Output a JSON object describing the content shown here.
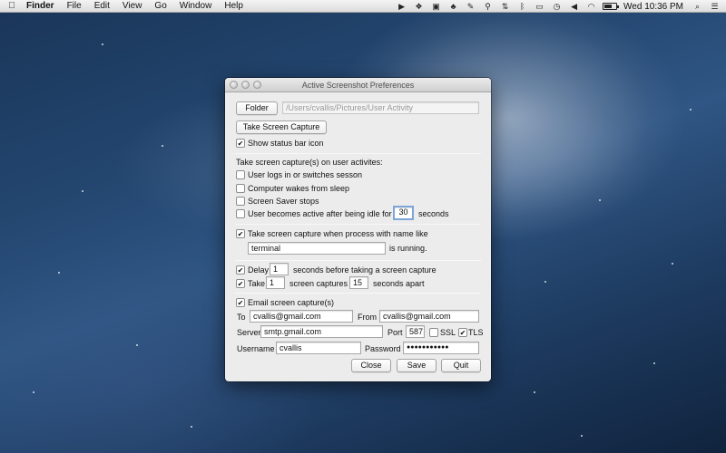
{
  "menubar": {
    "app": "Finder",
    "menus": [
      "File",
      "Edit",
      "View",
      "Go",
      "Window",
      "Help"
    ],
    "status_icons": [
      "screen-record-icon",
      "dropbox-icon",
      "window-icon",
      "evernote-icon",
      "pen-icon",
      "flashlight-icon",
      "network-icon",
      "bluetooth-icon",
      "screen-icon",
      "time-machine-icon",
      "volume-icon",
      "wifi-icon",
      "battery-icon",
      "search-icon",
      "list-icon"
    ],
    "battery_level": 0.65,
    "clock": "Wed 10:36 PM"
  },
  "window": {
    "title": "Active Screenshot Preferences",
    "folder_button": "Folder",
    "folder_path": "/Users/cvallis/Pictures/User Activity",
    "capture_button": "Take Screen Capture",
    "show_status_bar": {
      "label": "Show status bar icon",
      "checked": true
    },
    "activities_heading": "Take screen capture(s) on user activites:",
    "activities": [
      {
        "label": "User logs in or switches sesson",
        "checked": false
      },
      {
        "label": "Computer wakes from sleep",
        "checked": false
      },
      {
        "label": "Screen Saver stops",
        "checked": false
      }
    ],
    "idle": {
      "label": "User becomes active after being idle for",
      "checked": false,
      "value": "30",
      "unit": "seconds"
    },
    "process": {
      "label": "Take screen capture when process with name like",
      "checked": true,
      "name": "terminal",
      "suffix": "is running."
    },
    "delay": {
      "label": "Delay",
      "checked": true,
      "value": "1",
      "suffix": "seconds before taking a screen capture"
    },
    "take": {
      "label": "Take",
      "checked": true,
      "count": "1",
      "middle": "screen captures",
      "interval": "15",
      "suffix": "seconds apart"
    },
    "email": {
      "label": "Email screen capture(s)",
      "checked": true,
      "to_label": "To",
      "to": "cvallis@gmail.com",
      "from_label": "From",
      "from": "cvallis@gmail.com",
      "server_label": "Server",
      "server": "smtp.gmail.com",
      "port_label": "Port",
      "port": "587",
      "ssl_label": "SSL",
      "ssl": false,
      "tls_label": "TLS",
      "tls": true,
      "username_label": "Username",
      "username": "cvallis",
      "password_label": "Password",
      "password": "●●●●●●●●●●●"
    },
    "buttons": {
      "close": "Close",
      "save": "Save",
      "quit": "Quit"
    }
  }
}
